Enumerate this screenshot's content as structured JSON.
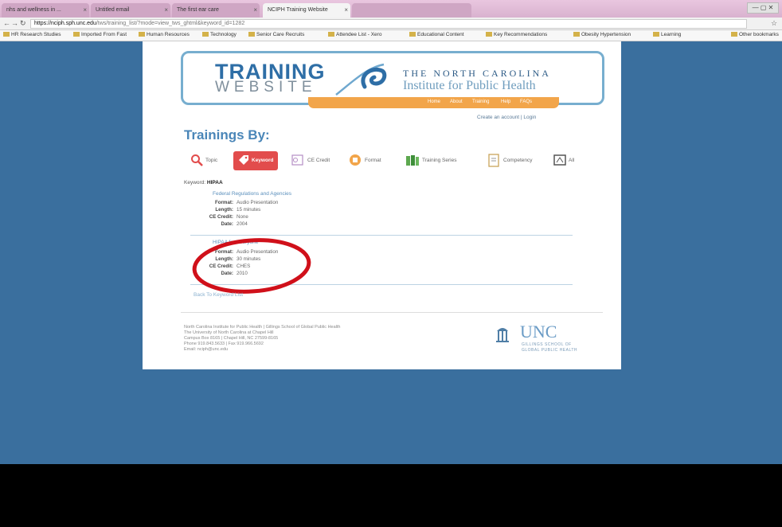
{
  "browser": {
    "tabs": [
      {
        "label": "nhs and wellness in ..."
      },
      {
        "label": "Untitled email"
      },
      {
        "label": "The first ear care"
      },
      {
        "label": "NCIPH Training Website"
      },
      {
        "label": ""
      }
    ],
    "url": {
      "host": "https://nciph.sph.unc.edu",
      "path": "/tws/training_list/?mode=view_tws_ghtml&keyword_id=1282"
    },
    "bookmarks": [
      "HR Research Studies",
      "Imported From Fast",
      "Human Resources",
      "Technology",
      "Senior Care Recruits",
      "Attendee List - Xero",
      "Educational Content",
      "Key Recommendations",
      "Obesity Hypertension",
      "Learning",
      "Other bookmarks"
    ]
  },
  "site": {
    "logo_training": "TRAINING",
    "logo_website": "WEBSITE",
    "institute_line1": "THE NORTH CAROLINA",
    "institute_line2": "Institute for Public Health",
    "orange_nav": [
      "Home",
      "About",
      "Training",
      "Help",
      "FAQs"
    ],
    "account_link": "Create an account | Login",
    "trainings_by": "Trainings By:",
    "filters": [
      {
        "label": "Topic",
        "icon": "magnifier-icon"
      },
      {
        "label": "Keyword",
        "icon": "tag-icon"
      },
      {
        "label": "CE Credit",
        "icon": "certificate-icon"
      },
      {
        "label": "Format",
        "icon": "format-icon"
      },
      {
        "label": "Training Series",
        "icon": "books-icon"
      },
      {
        "label": "Competency",
        "icon": "clipboard-icon"
      },
      {
        "label": "All",
        "icon": "all-icon"
      }
    ],
    "keyword_label": "Keyword:",
    "keyword_value": "HIPAA",
    "results": [
      {
        "title": "Federal Regulations and Agencies",
        "fields": [
          {
            "k": "Format:",
            "v": "Audio Presentation"
          },
          {
            "k": "Length:",
            "v": "15 minutes"
          },
          {
            "k": "CE Credit:",
            "v": "None"
          },
          {
            "k": "Date:",
            "v": "2004"
          }
        ]
      },
      {
        "title": "HIPAA for Everyone",
        "fields": [
          {
            "k": "Format:",
            "v": "Audio Presentation"
          },
          {
            "k": "Length:",
            "v": "30 minutes"
          },
          {
            "k": "CE Credit:",
            "v": "CHES"
          },
          {
            "k": "Date:",
            "v": "2010"
          }
        ]
      }
    ],
    "back_link": "Back To Keyword List",
    "footer_lines": [
      "North Carolina Institute for Public Health | Gillings School of Global Public Health",
      "The University of North Carolina at Chapel Hill",
      "Campus Box 8165 | Chapel Hill, NC 27599-8165",
      "Phone 919.843.5633 | Fax 919.966.5692",
      "Email: nciph@unc.edu"
    ],
    "unc_text": "UNC",
    "unc_sub1": "GILLINGS SCHOOL OF",
    "unc_sub2": "GLOBAL PUBLIC HEALTH"
  },
  "colors": {
    "desktop": "#3a6f9e",
    "accent_blue": "#4a86b8",
    "orange": "#f2a54a",
    "keyword_red": "#e24c4c",
    "annotation_red": "#d0101a"
  }
}
